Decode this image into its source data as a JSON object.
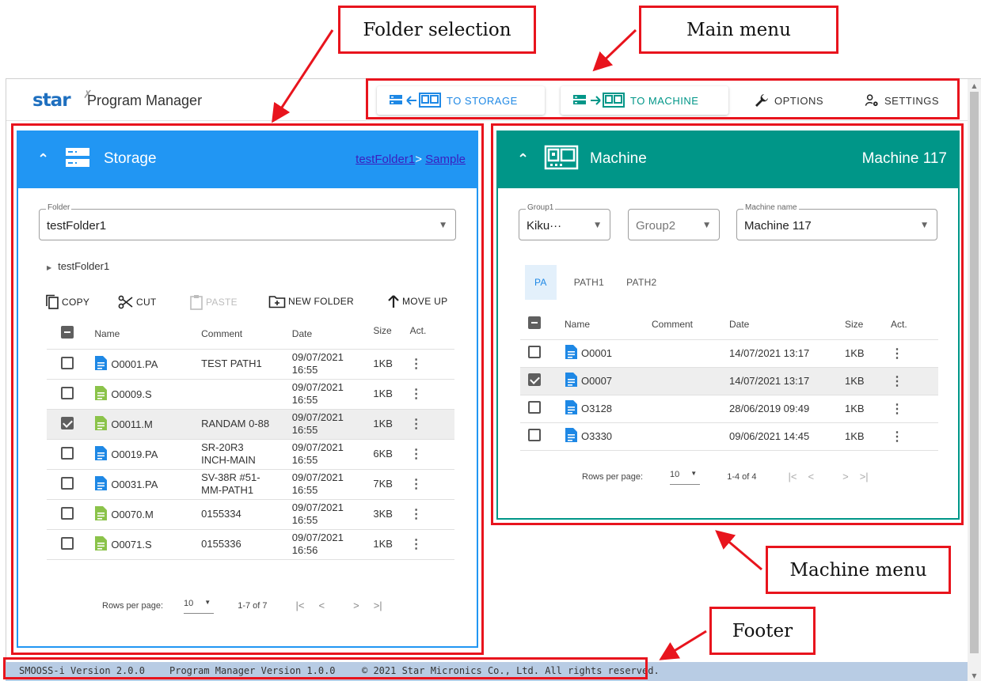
{
  "annotations": {
    "folder_selection": "Folder selection",
    "main_menu": "Main menu",
    "machine_menu": "Machine menu",
    "footer": "Footer"
  },
  "header": {
    "logo": "star",
    "title": "Program Manager",
    "menu": {
      "to_storage": "TO STORAGE",
      "to_machine": "TO MACHINE",
      "options": "OPTIONS",
      "settings": "SETTINGS"
    }
  },
  "storage": {
    "title": "Storage",
    "breadcrumb": {
      "folder": "testFolder1",
      "separator": ">",
      "sub": "Sample"
    },
    "folder_select": {
      "legend": "Folder",
      "value": "testFolder1"
    },
    "tree_item": "testFolder1",
    "toolbar": {
      "copy": "COPY",
      "cut": "CUT",
      "paste": "PASTE",
      "new_folder": "NEW FOLDER",
      "move_up": "MOVE UP"
    },
    "columns": {
      "name": "Name",
      "comment": "Comment",
      "date": "Date",
      "size": "Size",
      "act": "Act."
    },
    "rows": [
      {
        "name": "O0001.PA",
        "comment": "TEST PATH1",
        "date": "09/07/2021",
        "time": "16:55",
        "size": "1KB",
        "checked": false,
        "icon": "blue-file-icon"
      },
      {
        "name": "O0009.S",
        "comment": "",
        "date": "09/07/2021",
        "time": "16:55",
        "size": "1KB",
        "checked": false,
        "icon": "green-file-icon"
      },
      {
        "name": "O0011.M",
        "comment": "RANDAM 0-88",
        "date": "09/07/2021",
        "time": "16:55",
        "size": "1KB",
        "checked": true,
        "icon": "green-file-icon"
      },
      {
        "name": "O0019.PA",
        "comment": "SR-20R3",
        "comment2": "INCH-MAIN",
        "date": "09/07/2021",
        "time": "16:55",
        "size": "6KB",
        "checked": false,
        "icon": "blue-file-icon"
      },
      {
        "name": "O0031.PA",
        "comment": "SV-38R #51-",
        "comment2": "MM-PATH1",
        "date": "09/07/2021",
        "time": "16:55",
        "size": "7KB",
        "checked": false,
        "icon": "blue-file-icon"
      },
      {
        "name": "O0070.M",
        "comment": "0155334",
        "date": "09/07/2021",
        "time": "16:55",
        "size": "3KB",
        "checked": false,
        "icon": "green-file-icon"
      },
      {
        "name": "O0071.S",
        "comment": "0155336",
        "date": "09/07/2021",
        "time": "16:56",
        "size": "1KB",
        "checked": false,
        "icon": "green-file-icon"
      }
    ],
    "pager": {
      "rows_label": "Rows per page:",
      "rows_value": "10",
      "range": "1-7 of 7"
    }
  },
  "machine": {
    "title": "Machine",
    "current": "Machine 117",
    "group1": {
      "legend": "Group1",
      "value": "Kiku···"
    },
    "group2": {
      "value": "Group2"
    },
    "machine_name": {
      "legend": "Machine name",
      "value": "Machine 117"
    },
    "tabs": [
      "PA",
      "PATH1",
      "PATH2"
    ],
    "columns": {
      "name": "Name",
      "comment": "Comment",
      "date": "Date",
      "size": "Size",
      "act": "Act."
    },
    "rows": [
      {
        "name": "O0001",
        "date": "14/07/2021 13:17",
        "size": "1KB",
        "checked": false
      },
      {
        "name": "O0007",
        "date": "14/07/2021 13:17",
        "size": "1KB",
        "checked": true
      },
      {
        "name": "O3128",
        "date": "28/06/2019 09:49",
        "size": "1KB",
        "checked": false
      },
      {
        "name": "O3330",
        "date": "09/06/2021 14:45",
        "size": "1KB",
        "checked": false
      }
    ],
    "pager": {
      "rows_label": "Rows per page:",
      "rows_value": "10",
      "range": "1-4 of 4"
    }
  },
  "footer": {
    "smooss": "SMOOSS-i Version 2.0.0",
    "pm": "Program Manager Version 1.0.0",
    "copyright": "© 2021 Star Micronics Co., Ltd. All rights reserved."
  },
  "colors": {
    "storage": "#2196f3",
    "machine": "#009688",
    "annotation": "#e8141d",
    "footer": "#b8cce4"
  }
}
